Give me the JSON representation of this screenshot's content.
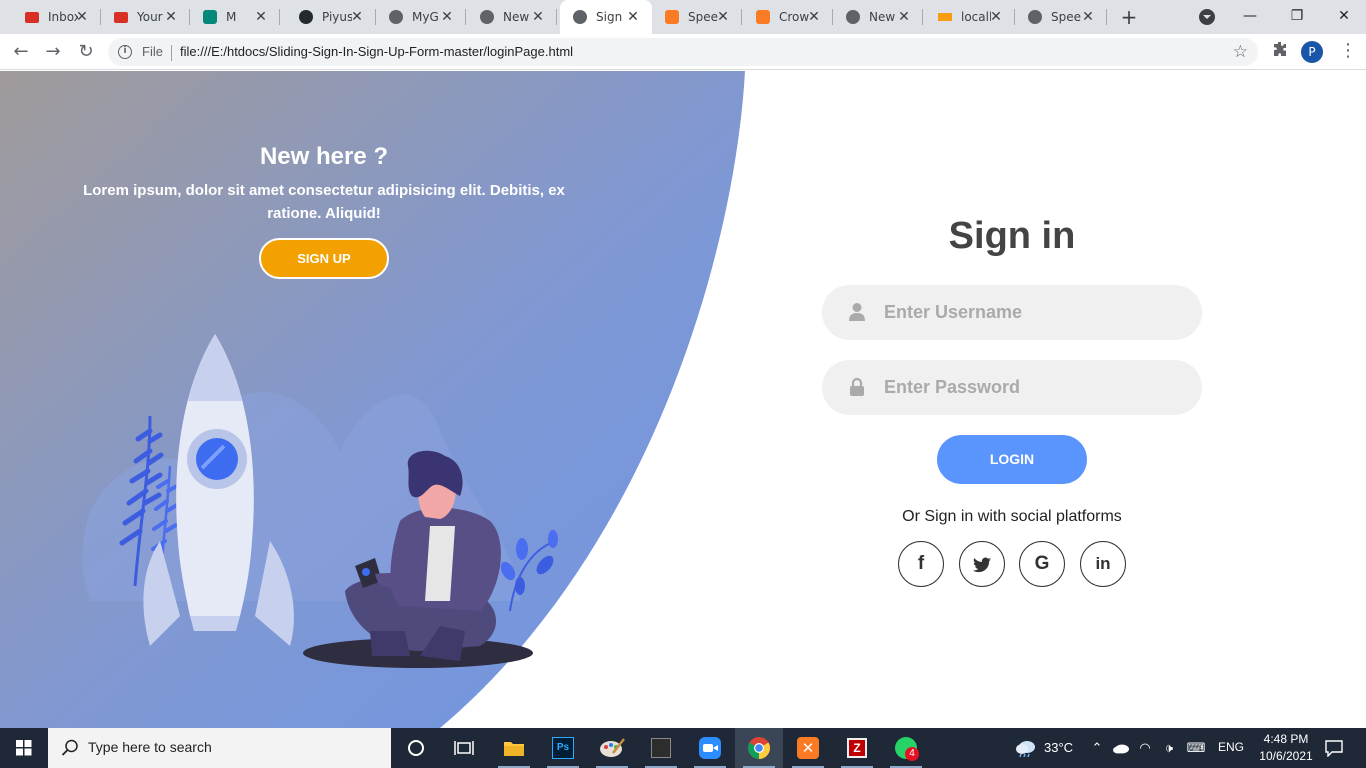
{
  "tabs": [
    {
      "title": "Inbox",
      "icon": "gmail-icon",
      "color": "#d93025",
      "active": false
    },
    {
      "title": "Your",
      "icon": "gmail-icon",
      "color": "#d93025",
      "active": false
    },
    {
      "title": "M",
      "icon": "meet-icon",
      "color": "#00897b",
      "active": false
    },
    {
      "title": "Piyus",
      "icon": "github-icon",
      "color": "#24292e",
      "active": false
    },
    {
      "title": "MyG",
      "icon": "globe-icon",
      "color": "#5f6368",
      "active": false
    },
    {
      "title": "New",
      "icon": "chrome-icon",
      "color": "#5f6368",
      "active": false
    },
    {
      "title": "Sign",
      "icon": "globe-icon",
      "color": "#5f6368",
      "active": true
    },
    {
      "title": "Spee",
      "icon": "xampp-icon",
      "color": "#fb7a24",
      "active": false
    },
    {
      "title": "Crow",
      "icon": "xampp-icon",
      "color": "#fb7a24",
      "active": false
    },
    {
      "title": "New",
      "icon": "chrome-icon",
      "color": "#5f6368",
      "active": false
    },
    {
      "title": "locall",
      "icon": "phpmyadmin-icon",
      "color": "#f89c0e",
      "active": false
    },
    {
      "title": "Spee",
      "icon": "globe-icon",
      "color": "#5f6368",
      "active": false
    }
  ],
  "omnibox": {
    "scheme_label": "File",
    "url": "file:///E:/htdocs/Sliding-Sign-In-Sign-Up-Form-master/loginPage.html"
  },
  "profile_initial": "P",
  "panel": {
    "title": "New here ?",
    "text": "Lorem ipsum, dolor sit amet consectetur adipisicing elit. Debitis, ex ratione. Aliquid!",
    "button": "SIGN UP"
  },
  "signin": {
    "title": "Sign in",
    "username_placeholder": "Enter Username",
    "password_placeholder": "Enter Password",
    "login_button": "LOGIN",
    "social_text": "Or Sign in with social platforms",
    "social": [
      {
        "name": "facebook",
        "glyph": "f"
      },
      {
        "name": "twitter",
        "glyph": "t"
      },
      {
        "name": "google",
        "glyph": "G"
      },
      {
        "name": "linkedin",
        "glyph": "in"
      }
    ]
  },
  "colors": {
    "accent": "#5995fd",
    "signup_button": "#f2a100",
    "panel_start": "#a09a9a",
    "panel_end": "#6f95e4"
  },
  "taskbar": {
    "search_placeholder": "Type here to search",
    "weather": "33°C",
    "language": "ENG",
    "time": "4:48 PM",
    "date": "10/6/2021",
    "whatsapp_badge": "4"
  }
}
